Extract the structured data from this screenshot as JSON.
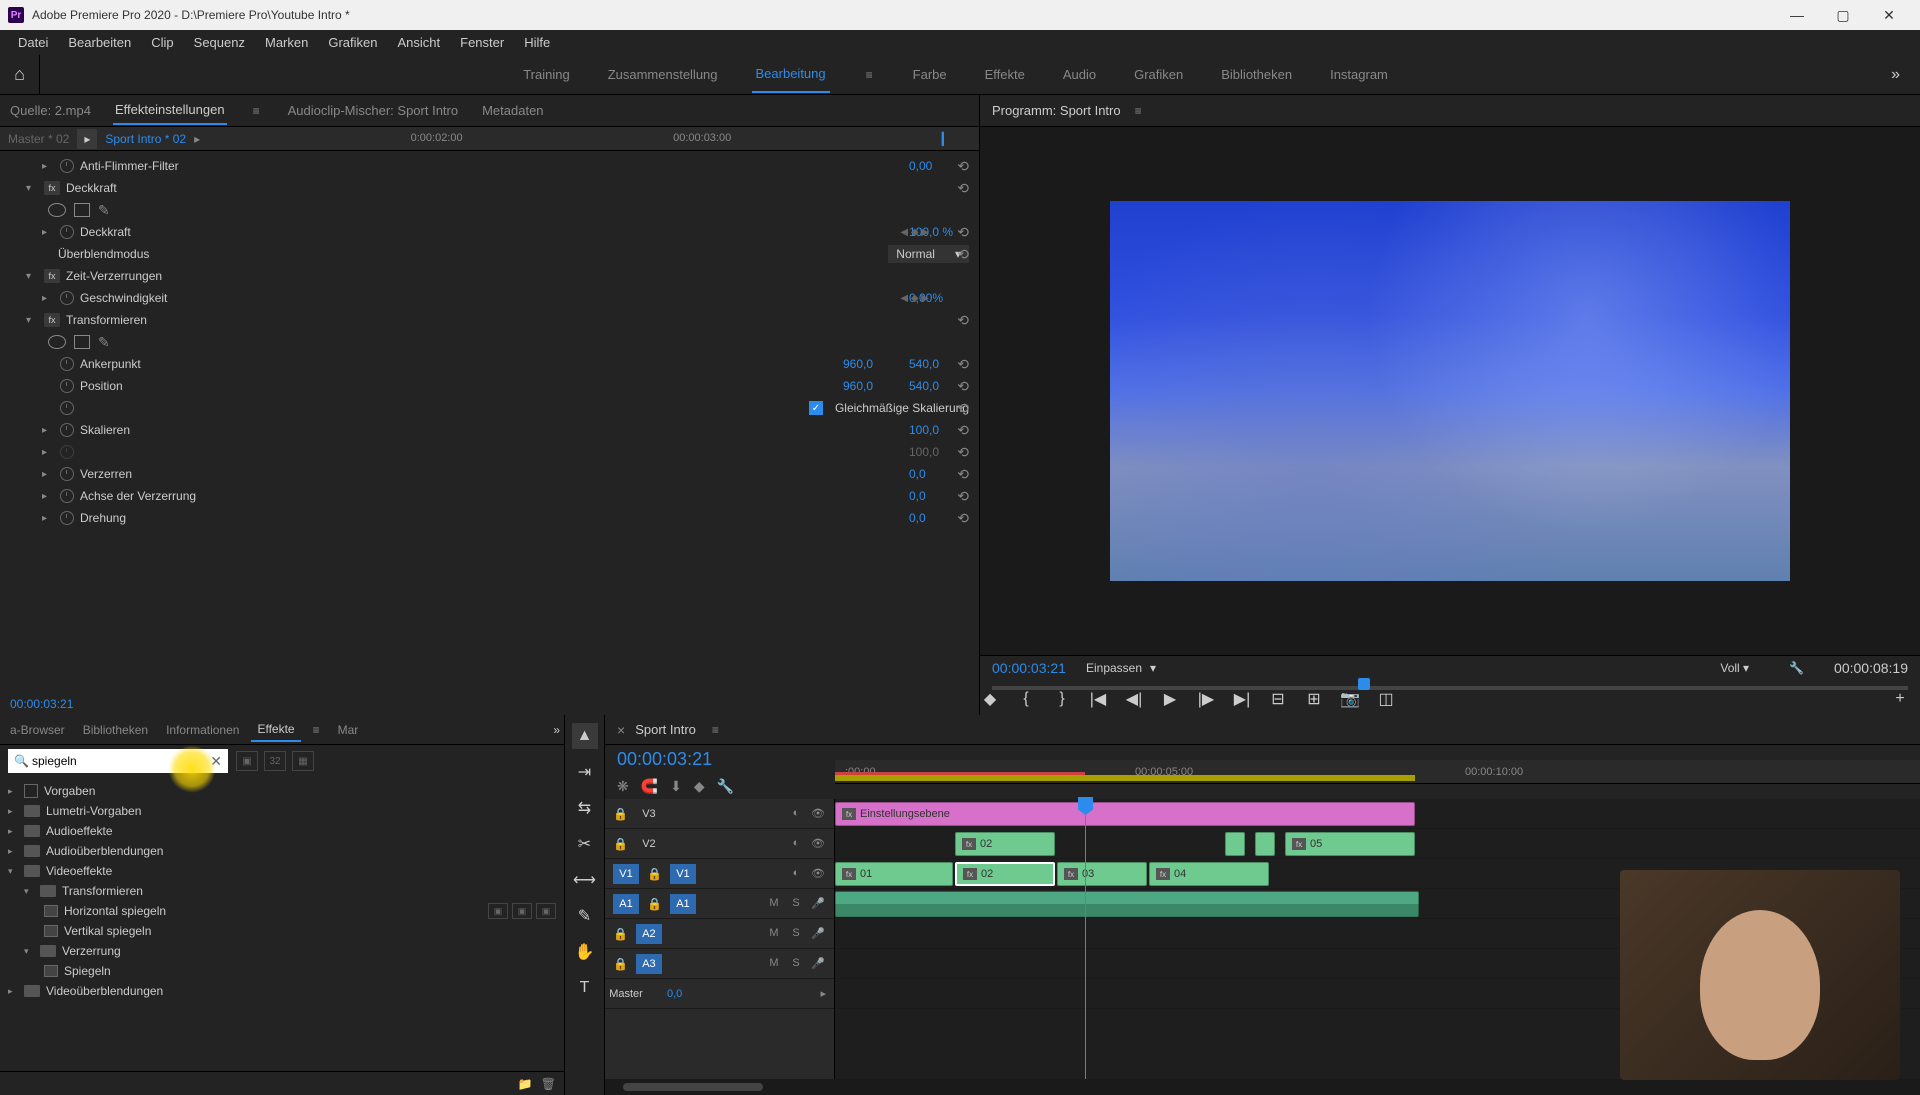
{
  "titlebar": {
    "icon": "Pr",
    "title": "Adobe Premiere Pro 2020 - D:\\Premiere Pro\\Youtube Intro *"
  },
  "menubar": [
    "Datei",
    "Bearbeiten",
    "Clip",
    "Sequenz",
    "Marken",
    "Grafiken",
    "Ansicht",
    "Fenster",
    "Hilfe"
  ],
  "workspace": {
    "tabs": [
      "Training",
      "Zusammenstellung",
      "Bearbeitung",
      "Farbe",
      "Effekte",
      "Audio",
      "Grafiken",
      "Bibliotheken",
      "Instagram"
    ],
    "active": "Bearbeitung"
  },
  "source_tabs": {
    "items": [
      "Quelle: 2.mp4",
      "Effekteinstellungen",
      "Audioclip-Mischer: Sport Intro",
      "Metadaten"
    ],
    "active": "Effekteinstellungen"
  },
  "master": {
    "label": "Master * 02",
    "active": "Sport Intro * 02",
    "time1": "0:00:02:00",
    "time2": "00:00:03:00"
  },
  "effects": {
    "antiflimmer": {
      "name": "Anti-Flimmer-Filter",
      "value": "0,00"
    },
    "deckkraft_header": "Deckkraft",
    "deckkraft": {
      "name": "Deckkraft",
      "value": "100,0 %"
    },
    "blend_label": "Überblendmodus",
    "blend_value": "Normal",
    "zeit": "Zeit-Verzerrungen",
    "speed": {
      "name": "Geschwindigkeit",
      "value": "0,00%"
    },
    "transform": "Transformieren",
    "anker": {
      "name": "Ankerpunkt",
      "v1": "960,0",
      "v2": "540,0"
    },
    "position": {
      "name": "Position",
      "v1": "960,0",
      "v2": "540,0"
    },
    "uniform": "Gleichmäßige Skalierung",
    "skalieren": {
      "name": "Skalieren",
      "value": "100,0"
    },
    "skalieren2": {
      "value": "100,0"
    },
    "verzerren": {
      "name": "Verzerren",
      "value": "0,0"
    },
    "achse": {
      "name": "Achse der Verzerrung",
      "value": "0,0"
    },
    "drehung": {
      "name": "Drehung",
      "value": "0,0"
    },
    "timecode": "00:00:03:21"
  },
  "program": {
    "title": "Programm: Sport Intro",
    "time": "00:00:03:21",
    "fit": "Einpassen",
    "full": "Voll",
    "duration": "00:00:08:19"
  },
  "fx_panel": {
    "tabs": [
      "a-Browser",
      "Bibliotheken",
      "Informationen",
      "Effekte",
      "Mar"
    ],
    "active": "Effekte",
    "search": "spiegeln",
    "tree": {
      "vorgaben": "Vorgaben",
      "lumetri": "Lumetri-Vorgaben",
      "audiofx": "Audioeffekte",
      "audioblend": "Audioüberblendungen",
      "videofx": "Videoeffekte",
      "transform": "Transformieren",
      "horiz": "Horizontal spiegeln",
      "vert": "Vertikal spiegeln",
      "verzerrung": "Verzerrung",
      "spiegeln": "Spiegeln",
      "videoblend": "Videoüberblendungen"
    }
  },
  "timeline": {
    "title": "Sport Intro",
    "timecode": "00:00:03:21",
    "ruler": {
      "t0": ":00:00",
      "t1": "00:00:05:00",
      "t2": "00:00:10:00"
    },
    "tracks": {
      "v3": "V3",
      "v2": "V2",
      "v1": "V1",
      "v1src": "V1",
      "a1": "A1",
      "a1src": "A1",
      "a2": "A2",
      "a3": "A3",
      "master": "Master",
      "master_val": "0,0"
    },
    "clips": {
      "adj": "Einstellungsebene",
      "c01": "01",
      "c02": "02",
      "c03": "03",
      "c04": "04",
      "c05": "05"
    }
  }
}
